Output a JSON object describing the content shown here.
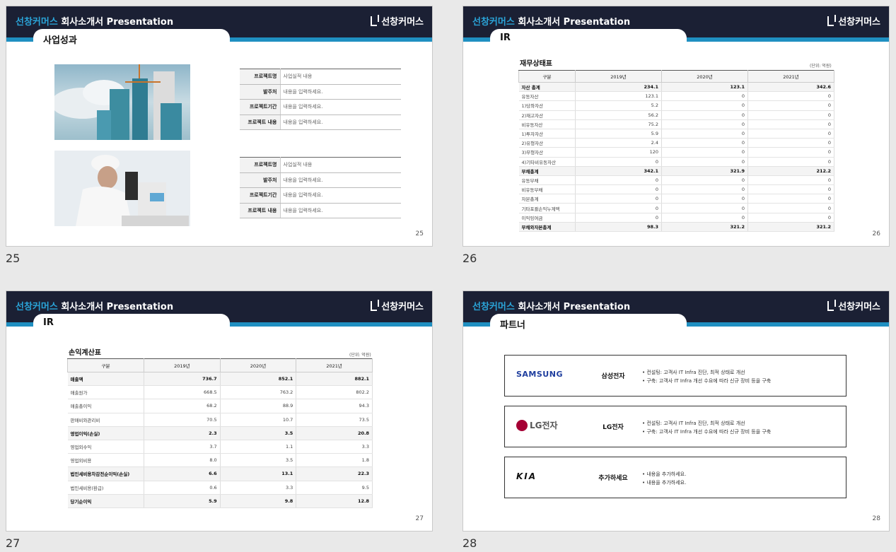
{
  "header": {
    "brand": "선창커머스",
    "title_rest": "회사소개서 Presentation",
    "logo_text": "선창커머스"
  },
  "slides": [
    {
      "number": "25",
      "section": "사업성과",
      "projects": [
        {
          "rows": [
            {
              "key": "프로젝트명",
              "value": "사업실적 내용"
            },
            {
              "key": "발주처",
              "value": "내용을 입력하세요."
            },
            {
              "key": "프로젝트기간",
              "value": "내용을 입력하세요."
            },
            {
              "key": "프로젝트 내용",
              "value": "내용을 입력하세요."
            }
          ]
        },
        {
          "rows": [
            {
              "key": "프로젝트명",
              "value": "사업실적 내용"
            },
            {
              "key": "발주처",
              "value": "내용을 입력하세요."
            },
            {
              "key": "프로젝트기간",
              "value": "내용을 입력하세요."
            },
            {
              "key": "프로젝트 내용",
              "value": "내용을 입력하세요."
            }
          ]
        }
      ]
    },
    {
      "number": "26",
      "section": "IR",
      "table_title": "재무상태표",
      "unit": "(단위: 억원)",
      "columns": [
        "구분",
        "2019년",
        "2020년",
        "2021년"
      ],
      "rows": [
        {
          "label": "자산 총계",
          "v": [
            "234.1",
            "123.1",
            "342.6"
          ],
          "bold": true
        },
        {
          "label": "유동자산",
          "v": [
            "123.1",
            "0",
            "0"
          ]
        },
        {
          "label": "1)당좌자산",
          "v": [
            "5.2",
            "0",
            "0"
          ]
        },
        {
          "label": "2)재고자산",
          "v": [
            "56.2",
            "0",
            "0"
          ]
        },
        {
          "label": "비유동자산",
          "v": [
            "75.2",
            "0",
            "0"
          ]
        },
        {
          "label": "1)투자자산",
          "v": [
            "5.9",
            "0",
            "0"
          ]
        },
        {
          "label": "2)유형자산",
          "v": [
            "2.4",
            "0",
            "0"
          ]
        },
        {
          "label": "3)무형자산",
          "v": [
            "120",
            "0",
            "0"
          ]
        },
        {
          "label": "4)기타비유동자산",
          "v": [
            "0",
            "0",
            "0"
          ]
        },
        {
          "label": "부채총계",
          "v": [
            "342.1",
            "321.9",
            "212.2"
          ],
          "bold": true
        },
        {
          "label": "유동부채",
          "v": [
            "0",
            "0",
            "0"
          ]
        },
        {
          "label": "비유동부채",
          "v": [
            "0",
            "0",
            "0"
          ]
        },
        {
          "label": "자본총계",
          "v": [
            "0",
            "0",
            "0"
          ]
        },
        {
          "label": "기타포괄손익누계액",
          "v": [
            "0",
            "0",
            "0"
          ]
        },
        {
          "label": "이익잉여금",
          "v": [
            "0",
            "0",
            "0"
          ]
        },
        {
          "label": "부채와자본총계",
          "v": [
            "98.3",
            "321.2",
            "321.2"
          ],
          "bold": true
        }
      ]
    },
    {
      "number": "27",
      "section": "IR",
      "table_title": "손익계산표",
      "unit": "(단위: 억원)",
      "columns": [
        "구분",
        "2019년",
        "2020년",
        "2021년"
      ],
      "rows": [
        {
          "label": "매출액",
          "v": [
            "736.7",
            "852.1",
            "882.1"
          ],
          "bold": true
        },
        {
          "label": "매출원가",
          "v": [
            "668.5",
            "763.2",
            "802.2"
          ]
        },
        {
          "label": "매출총이익",
          "v": [
            "68.2",
            "88.9",
            "94.3"
          ]
        },
        {
          "label": "판매비와관리비",
          "v": [
            "70.5",
            "10.7",
            "73.5"
          ]
        },
        {
          "label": "영업이익(손실)",
          "v": [
            "2.3",
            "3.5",
            "20.8"
          ],
          "bold": true
        },
        {
          "label": "영업외수익",
          "v": [
            "3.7",
            "1.1",
            "3.3"
          ]
        },
        {
          "label": "영업외비용",
          "v": [
            "8.0",
            "3.5",
            "1.8"
          ]
        },
        {
          "label": "법인세비용차감전순이익(손실)",
          "v": [
            "6.6",
            "13.1",
            "22.3"
          ],
          "bold": true
        },
        {
          "label": "법인세비용(환급)",
          "v": [
            "0.6",
            "3.3",
            "9.5"
          ]
        },
        {
          "label": "당기순이익",
          "v": [
            "5.9",
            "9.8",
            "12.8"
          ],
          "bold": true
        }
      ]
    },
    {
      "number": "28",
      "section": "파트너",
      "partners": [
        {
          "logo": "SAMSUNG",
          "name": "삼성전자",
          "bullets": [
            "컨설팅: 고객사 IT Infra 진단, 최적 상태로 개선",
            "구축: 고객사 IT Infra 개선 수요에 따라 신규 장비 등을 구축"
          ]
        },
        {
          "logo": "LG전자",
          "name": "LG전자",
          "bullets": [
            "컨설팅: 고객사 IT Infra 진단, 최적 상태로 개선",
            "구축: 고객사 IT Infra 개선 수요에 따라 신규 장비 등을 구축"
          ]
        },
        {
          "logo": "KIA",
          "name": "추가하세요",
          "bullets": [
            "내용을 추가하세요.",
            "내용을 추가하세요."
          ]
        }
      ]
    }
  ]
}
